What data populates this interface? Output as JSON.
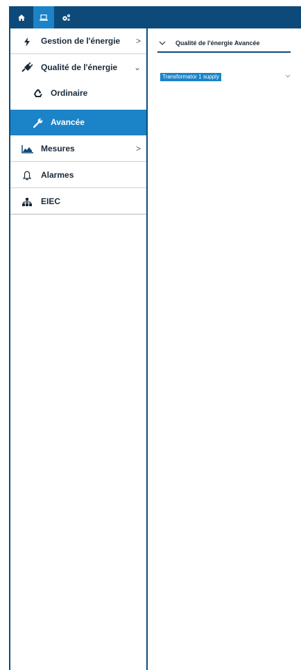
{
  "toolbar": {
    "items": [
      {
        "icon": "home-icon",
        "active": false
      },
      {
        "icon": "laptop-icon",
        "active": true
      },
      {
        "icon": "cogs-icon",
        "active": false
      }
    ]
  },
  "sidebar": {
    "items": [
      {
        "label": "Gestion de l'énergie",
        "icon": "lightning-icon",
        "chevron": ">"
      },
      {
        "label": "Qualité de l'énergie",
        "icon": "plug-icon",
        "chevron": "⌄"
      },
      {
        "label": "Ordinaire",
        "icon": "recycle-icon"
      },
      {
        "label": "Avancée",
        "icon": "wrench-icon",
        "active": true
      },
      {
        "label": "Mesures",
        "icon": "area-chart-icon",
        "chevron": ">"
      },
      {
        "label": "Alarmes",
        "icon": "bell-icon"
      },
      {
        "label": "EIEC",
        "icon": "sitemap-icon"
      }
    ]
  },
  "content": {
    "title": "Qualité de l'énergie Avancée",
    "select": {
      "value": "Transformator 1 supply"
    }
  },
  "colors": {
    "topbar": "#0d4a7a",
    "accent": "#1b83c8",
    "border": "#0d4a7a"
  }
}
